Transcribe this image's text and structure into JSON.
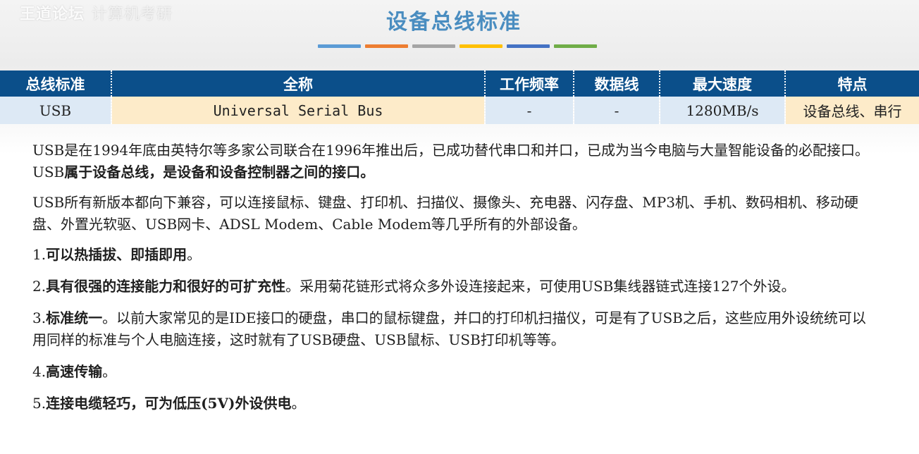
{
  "watermark": {
    "main": "王道论坛",
    "faded": "计算机考研"
  },
  "title": "设备总线标准",
  "deco_colors": [
    "#5b9bd5",
    "#ed7d31",
    "#a5a5a5",
    "#ffc000",
    "#4472c4",
    "#70ad47"
  ],
  "table": {
    "headers": [
      "总线标准",
      "全称",
      "工作频率",
      "数据线",
      "最大速度",
      "特点"
    ],
    "row": {
      "name": "USB",
      "full": "Universal Serial Bus",
      "freq": "-",
      "data": "-",
      "speed": "1280MB/s",
      "feature": "设备总线、串行"
    }
  },
  "content": {
    "p1_text": "USB是在1994年底由英特尔等多家公司联合在1996年推出后，已成功替代串口和并口，已成为当今电脑与大量智能设备的必配接口。USB",
    "p1_bold": "属于设备总线，是设备和设备控制器之间的接口。",
    "p2": "USB所有新版本都向下兼容，可以连接鼠标、键盘、打印机、扫描仪、摄像头、充电器、闪存盘、MP3机、手机、数码相机、移动硬盘、外置光软驱、USB网卡、ADSL Modem、Cable Modem等几乎所有的外部设备。",
    "i1_num": "1.",
    "i1_bold": "可以热插拔、即插即用",
    "i1_tail": "。",
    "i2_num": "2.",
    "i2_bold": "具有很强的连接能力和很好的可扩充性",
    "i2_tail": "。采用菊花链形式将众多外设连接起来，可使用USB集线器链式连接127个外设。",
    "i3_num": "3.",
    "i3_bold": "标准统一",
    "i3_tail": "。以前大家常见的是IDE接口的硬盘，串口的鼠标键盘，并口的打印机扫描仪，可是有了USB之后，这些应用外设统统可以用同样的标准与个人电脑连接，这时就有了USB硬盘、USB鼠标、USB打印机等等。",
    "i4_num": "4.",
    "i4_bold": "高速传输",
    "i4_tail": "。",
    "i5_num": "5.",
    "i5_bold": "连接电缆轻巧，可为低压(5V)外设供电",
    "i5_tail": "。"
  }
}
